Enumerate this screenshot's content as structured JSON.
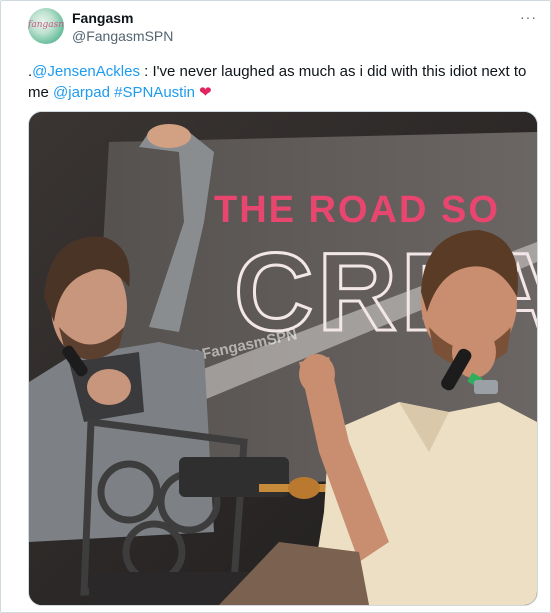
{
  "author": {
    "display_name": "Fangasm",
    "handle": "@FangasmSPN",
    "avatar_text": "fangasm"
  },
  "more_label": "···",
  "tweet": {
    "prefix": ".",
    "mention1": "@JensenAckles",
    "body": " : I've never laughed as much as i did with this idiot next to me ",
    "mention2": "@jarpad",
    "space": " ",
    "hashtag": "#SPNAustin",
    "emoji": "❤"
  },
  "photo": {
    "banner_line1": "THE ROAD SO",
    "banner_line2": "CREA",
    "watermark": "@FangasmSPN"
  }
}
